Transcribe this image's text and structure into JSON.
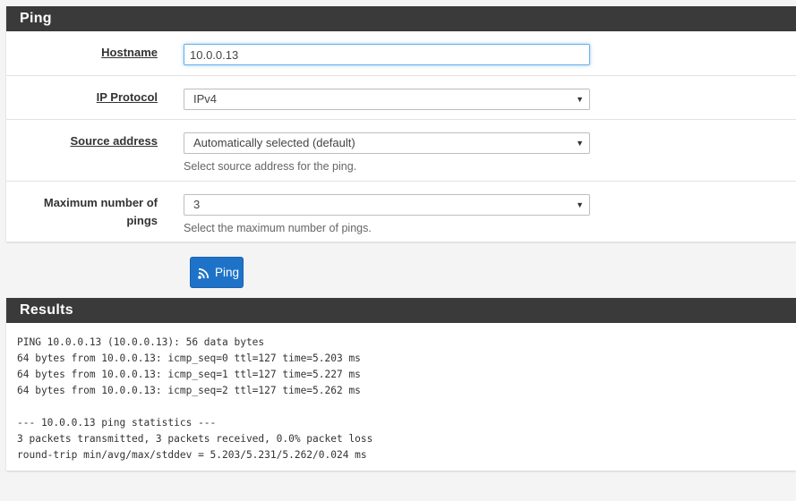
{
  "ping_panel": {
    "title": "Ping",
    "hostname": {
      "label": "Hostname",
      "value": "10.0.0.13"
    },
    "ip_protocol": {
      "label": "IP Protocol",
      "selected": "IPv4"
    },
    "source_address": {
      "label": "Source address",
      "selected": "Automatically selected (default)",
      "help": "Select source address for the ping."
    },
    "max_pings": {
      "label_line1": "Maximum number of",
      "label_line2": "pings",
      "selected": "3",
      "help": "Select the maximum number of pings."
    },
    "caret_glyph": "▼"
  },
  "ping_button": {
    "label": "Ping",
    "icon": "rss-icon",
    "color": "#1e73c9"
  },
  "results_panel": {
    "title": "Results",
    "output": "PING 10.0.0.13 (10.0.0.13): 56 data bytes\n64 bytes from 10.0.0.13: icmp_seq=0 ttl=127 time=5.203 ms\n64 bytes from 10.0.0.13: icmp_seq=1 ttl=127 time=5.227 ms\n64 bytes from 10.0.0.13: icmp_seq=2 ttl=127 time=5.262 ms\n\n--- 10.0.0.13 ping statistics ---\n3 packets transmitted, 3 packets received, 0.0% packet loss\nround-trip min/avg/max/stddev = 5.203/5.231/5.262/0.024 ms"
  },
  "colors": {
    "panel_heading": "#3a3a3a",
    "page_background": "#f4f4f4",
    "focus_border": "#66afe9"
  }
}
